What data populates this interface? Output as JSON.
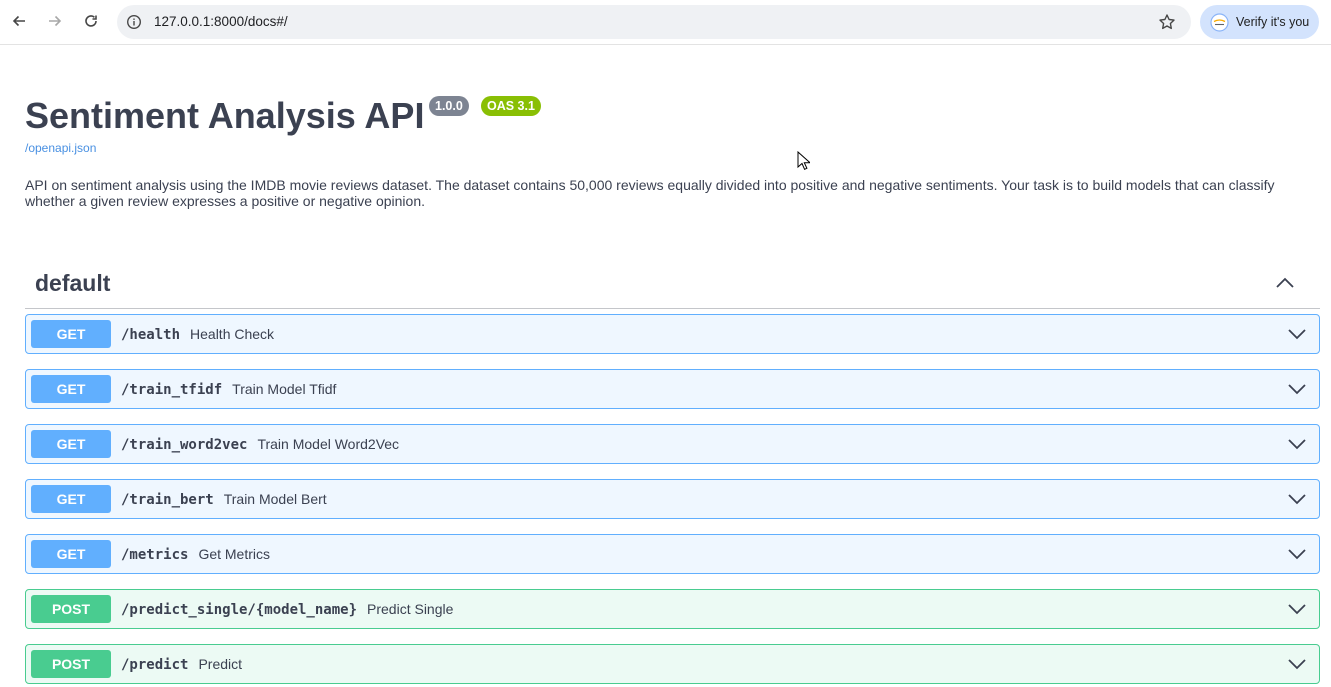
{
  "browser": {
    "url": "127.0.0.1:8000/docs#/",
    "verify_label": "Verify it's you"
  },
  "info": {
    "title": "Sentiment Analysis API",
    "version": "1.0.0",
    "oas": "OAS 3.1",
    "spec_link": "/openapi.json",
    "description": "API on sentiment analysis using the IMDB movie reviews dataset. The dataset contains 50,000 reviews equally divided into positive and negative sentiments. Your task is to build models that can classify whether a given review expresses a positive or negative opinion."
  },
  "section": {
    "title": "default",
    "expanded": true
  },
  "operations": [
    {
      "method": "GET",
      "path": "/health",
      "summary": "Health Check"
    },
    {
      "method": "GET",
      "path": "/train_tfidf",
      "summary": "Train Model Tfidf"
    },
    {
      "method": "GET",
      "path": "/train_word2vec",
      "summary": "Train Model Word2Vec"
    },
    {
      "method": "GET",
      "path": "/train_bert",
      "summary": "Train Model Bert"
    },
    {
      "method": "GET",
      "path": "/metrics",
      "summary": "Get Metrics"
    },
    {
      "method": "POST",
      "path": "/predict_single/{model_name}",
      "summary": "Predict Single"
    },
    {
      "method": "POST",
      "path": "/predict",
      "summary": "Predict"
    }
  ],
  "colors": {
    "get": "#61affe",
    "post": "#49cc90",
    "version_badge": "#7d8492",
    "oas_badge": "#89bf04",
    "link": "#4990e2"
  }
}
